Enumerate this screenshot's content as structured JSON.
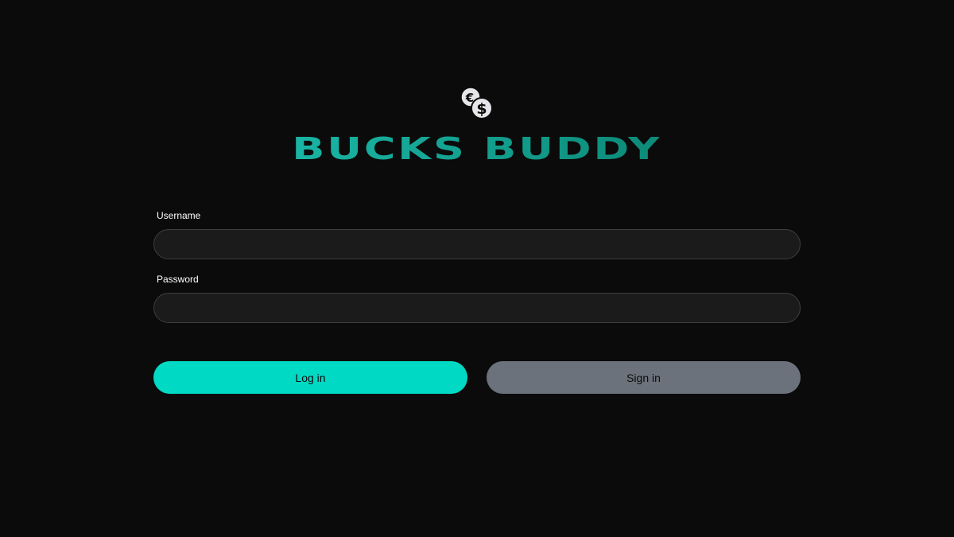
{
  "app": {
    "title": "BUCKS BUDDY",
    "logo_icon": "coins-euro-dollar-icon"
  },
  "form": {
    "username_label": "Username",
    "username_value": "",
    "password_label": "Password",
    "password_value": ""
  },
  "actions": {
    "login_label": "Log in",
    "signin_label": "Sign in"
  },
  "colors": {
    "background": "#0b0b0b",
    "brand_gradient_start": "#1ab5a5",
    "brand_gradient_end": "#0d8a78",
    "login_button": "#00d9c4",
    "signin_button": "#6b727b",
    "input_background": "#1b1b1b",
    "input_border": "#3e3e3e"
  }
}
